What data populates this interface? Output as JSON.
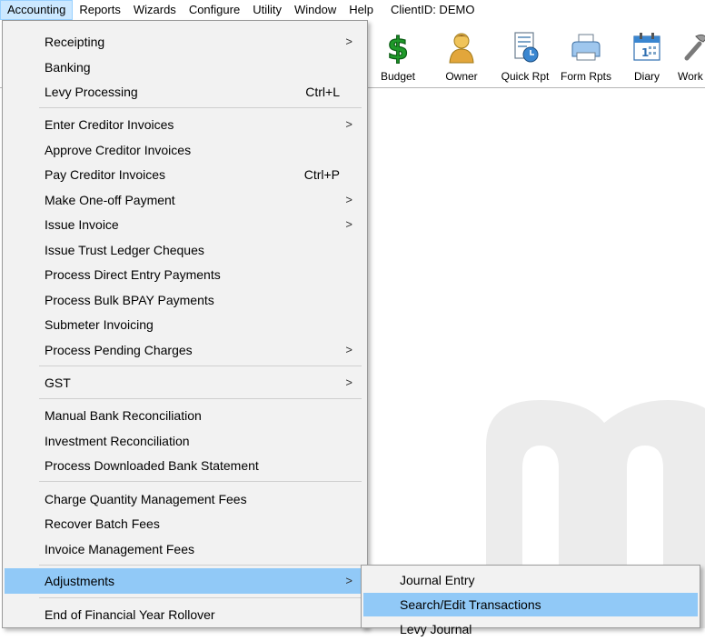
{
  "menubar": {
    "items": [
      "Accounting",
      "Reports",
      "Wizards",
      "Configure",
      "Utility",
      "Window",
      "Help"
    ],
    "client": "ClientID: DEMO"
  },
  "toolbar": {
    "buttons": [
      {
        "label": "Budget",
        "icon": "dollar-icon"
      },
      {
        "label": "Owner",
        "icon": "person-icon"
      },
      {
        "label": "Quick Rpt",
        "icon": "report-clock-icon"
      },
      {
        "label": "Form Rpts",
        "icon": "printer-icon"
      },
      {
        "label": "Diary",
        "icon": "calendar-icon"
      },
      {
        "label": "Work",
        "icon": "tools-icon"
      }
    ]
  },
  "menu": {
    "items": [
      {
        "label": "Receipting",
        "shortcut": "",
        "submenu": true
      },
      {
        "label": "Banking",
        "shortcut": "",
        "submenu": false
      },
      {
        "label": "Levy Processing",
        "shortcut": "Ctrl+L",
        "submenu": false
      },
      {
        "label": "Enter Creditor Invoices",
        "shortcut": "",
        "submenu": true
      },
      {
        "label": "Approve Creditor Invoices",
        "shortcut": "",
        "submenu": false
      },
      {
        "label": "Pay Creditor Invoices",
        "shortcut": "Ctrl+P",
        "submenu": false
      },
      {
        "label": "Make One-off Payment",
        "shortcut": "",
        "submenu": true
      },
      {
        "label": "Issue Invoice",
        "shortcut": "",
        "submenu": true
      },
      {
        "label": "Issue Trust Ledger Cheques",
        "shortcut": "",
        "submenu": false
      },
      {
        "label": "Process Direct Entry Payments",
        "shortcut": "",
        "submenu": false
      },
      {
        "label": "Process Bulk BPAY Payments",
        "shortcut": "",
        "submenu": false
      },
      {
        "label": "Submeter Invoicing",
        "shortcut": "",
        "submenu": false
      },
      {
        "label": "Process Pending Charges",
        "shortcut": "",
        "submenu": true
      },
      {
        "label": "GST",
        "shortcut": "",
        "submenu": true
      },
      {
        "label": "Manual Bank Reconciliation",
        "shortcut": "",
        "submenu": false
      },
      {
        "label": "Investment Reconciliation",
        "shortcut": "",
        "submenu": false
      },
      {
        "label": "Process Downloaded Bank Statement",
        "shortcut": "",
        "submenu": false
      },
      {
        "label": "Charge Quantity Management Fees",
        "shortcut": "",
        "submenu": false
      },
      {
        "label": "Recover Batch Fees",
        "shortcut": "",
        "submenu": false
      },
      {
        "label": "Invoice Management Fees",
        "shortcut": "",
        "submenu": false
      },
      {
        "label": "Adjustments",
        "shortcut": "",
        "submenu": true
      },
      {
        "label": "End of Financial Year Rollover",
        "shortcut": "",
        "submenu": false
      }
    ],
    "arrow": ">"
  },
  "submenu": {
    "items": [
      {
        "label": "Journal Entry"
      },
      {
        "label": "Search/Edit Transactions"
      },
      {
        "label": "Levy Journal"
      }
    ]
  },
  "colors": {
    "menu_bg": "#f2f2f2",
    "highlight": "#91c9f7",
    "menubar_active": "#cce8ff",
    "watermark": "#ececec"
  }
}
